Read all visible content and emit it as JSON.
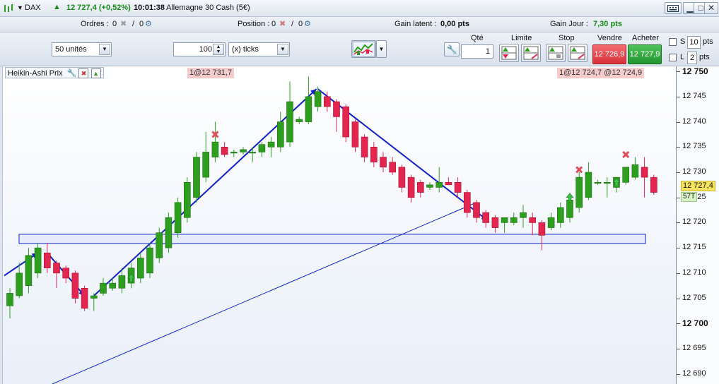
{
  "header": {
    "instrument": "DAX",
    "last_price": "12 727,4 (+0,52%)",
    "time": "10:01:38",
    "description": "Allemagne 30 Cash (5€)"
  },
  "orders_bar": {
    "ordres_label": "Ordres :",
    "ordres_value": "0",
    "ordres_count": "0",
    "position_label": "Position :",
    "position_value": "0",
    "position_count": "0",
    "gain_latent_label": "Gain latent :",
    "gain_latent_value": "0,00 pts",
    "gain_jour_label": "Gain Jour :",
    "gain_jour_value": "7,30 pts"
  },
  "toolbar": {
    "units_select": "50 unités",
    "ticks_value": "100",
    "ticks_select": "(x) ticks",
    "qty_label": "Qté",
    "qty_value": "1",
    "limite_label": "Limite",
    "stop_label": "Stop",
    "vendre_label": "Vendre",
    "vendre_price": "12 726,9",
    "acheter_label": "Acheter",
    "acheter_price": "12 727,9",
    "s_label": "S",
    "s_value": "10",
    "l_label": "L",
    "l_value": "2",
    "pts_label": "pts",
    "colors": {
      "sell": "#e8434b",
      "buy": "#2ea83a"
    }
  },
  "chart": {
    "indicator_label": "Heikin-Ashi Prix",
    "order_pill_left": "1@12 731,7",
    "order_pill_right": "1@12 724,7 @12 724,9",
    "current_price_tag": "12 727,4",
    "volume_tag": "57T",
    "colors": {
      "up": "#2e9e1f",
      "down": "#e32550",
      "trendline": "#1020c8",
      "zone": "#dde6fa"
    }
  },
  "chart_data": {
    "type": "candlestick",
    "style": "Heikin-Ashi",
    "ylim": [
      12688,
      12751
    ],
    "y_ticks": [
      "12 750",
      "12 745",
      "12 740",
      "12 735",
      "12 730",
      "12 725",
      "12 720",
      "12 715",
      "12 710",
      "12 705",
      "12 700",
      "12 695",
      "12 690"
    ],
    "y_tick_values": [
      12750,
      12745,
      12740,
      12735,
      12730,
      12725,
      12720,
      12715,
      12710,
      12705,
      12700,
      12695,
      12690
    ],
    "major_ticks": [
      12750,
      12700
    ],
    "candles": [
      {
        "o": 12703.5,
        "h": 12707,
        "l": 12701,
        "c": 12706
      },
      {
        "o": 12705.5,
        "h": 12712,
        "l": 12705,
        "c": 12710
      },
      {
        "o": 12707.5,
        "h": 12715,
        "l": 12706,
        "c": 12713.5
      },
      {
        "o": 12710,
        "h": 12716,
        "l": 12709,
        "c": 12715
      },
      {
        "o": 12714,
        "h": 12716,
        "l": 12710,
        "c": 12711
      },
      {
        "o": 12712,
        "h": 12712.5,
        "l": 12707,
        "c": 12710
      },
      {
        "o": 12711,
        "h": 12711.5,
        "l": 12708,
        "c": 12709
      },
      {
        "o": 12710,
        "h": 12710.5,
        "l": 12704,
        "c": 12705
      },
      {
        "o": 12707,
        "h": 12707.5,
        "l": 12702.5,
        "c": 12703
      },
      {
        "o": 12705,
        "h": 12706,
        "l": 12702.5,
        "c": 12705.5
      },
      {
        "o": 12706,
        "h": 12709,
        "l": 12705.5,
        "c": 12708
      },
      {
        "o": 12707,
        "h": 12709,
        "l": 12706.5,
        "c": 12708
      },
      {
        "o": 12707,
        "h": 12711,
        "l": 12706,
        "c": 12709.5
      },
      {
        "o": 12708,
        "h": 12712,
        "l": 12707,
        "c": 12711
      },
      {
        "o": 12709,
        "h": 12714,
        "l": 12708,
        "c": 12713
      },
      {
        "o": 12710,
        "h": 12716,
        "l": 12709,
        "c": 12715
      },
      {
        "o": 12713,
        "h": 12719,
        "l": 12712,
        "c": 12718
      },
      {
        "o": 12715,
        "h": 12722,
        "l": 12714,
        "c": 12721
      },
      {
        "o": 12718,
        "h": 12725,
        "l": 12717,
        "c": 12724
      },
      {
        "o": 12721,
        "h": 12729,
        "l": 12720,
        "c": 12728
      },
      {
        "o": 12725,
        "h": 12734,
        "l": 12724,
        "c": 12733
      },
      {
        "o": 12729,
        "h": 12738,
        "l": 12728,
        "c": 12734
      },
      {
        "o": 12733,
        "h": 12740,
        "l": 12732,
        "c": 12736
      },
      {
        "o": 12735,
        "h": 12736,
        "l": 12733,
        "c": 12733.5
      },
      {
        "o": 12734,
        "h": 12734.5,
        "l": 12733,
        "c": 12734
      },
      {
        "o": 12734,
        "h": 12735,
        "l": 12733.5,
        "c": 12734.5
      },
      {
        "o": 12734,
        "h": 12735,
        "l": 12732,
        "c": 12734
      },
      {
        "o": 12734,
        "h": 12736,
        "l": 12733,
        "c": 12735.5
      },
      {
        "o": 12735,
        "h": 12737,
        "l": 12733,
        "c": 12736
      },
      {
        "o": 12735,
        "h": 12742,
        "l": 12734,
        "c": 12740
      },
      {
        "o": 12736,
        "h": 12748,
        "l": 12735,
        "c": 12744
      },
      {
        "o": 12740,
        "h": 12741,
        "l": 12739.5,
        "c": 12740.5
      },
      {
        "o": 12740,
        "h": 12749,
        "l": 12739.5,
        "c": 12745
      },
      {
        "o": 12743,
        "h": 12747,
        "l": 12742,
        "c": 12746
      },
      {
        "o": 12745,
        "h": 12746,
        "l": 12742,
        "c": 12743
      },
      {
        "o": 12744,
        "h": 12744.5,
        "l": 12738,
        "c": 12741
      },
      {
        "o": 12743,
        "h": 12743.5,
        "l": 12736,
        "c": 12737
      },
      {
        "o": 12740,
        "h": 12740.5,
        "l": 12734,
        "c": 12735
      },
      {
        "o": 12737,
        "h": 12737.5,
        "l": 12732,
        "c": 12733
      },
      {
        "o": 12735,
        "h": 12736,
        "l": 12731,
        "c": 12732
      },
      {
        "o": 12733,
        "h": 12734,
        "l": 12730,
        "c": 12731
      },
      {
        "o": 12732,
        "h": 12733,
        "l": 12729.5,
        "c": 12730
      },
      {
        "o": 12731,
        "h": 12731.5,
        "l": 12726,
        "c": 12727
      },
      {
        "o": 12729,
        "h": 12729.5,
        "l": 12724,
        "c": 12725
      },
      {
        "o": 12728,
        "h": 12728.5,
        "l": 12725,
        "c": 12726
      },
      {
        "o": 12727,
        "h": 12728,
        "l": 12726.5,
        "c": 12727.5
      },
      {
        "o": 12727,
        "h": 12731,
        "l": 12726,
        "c": 12728
      },
      {
        "o": 12728,
        "h": 12729,
        "l": 12727.5,
        "c": 12727.5
      },
      {
        "o": 12728,
        "h": 12729,
        "l": 12725,
        "c": 12726
      },
      {
        "o": 12726,
        "h": 12726.5,
        "l": 12721,
        "c": 12722
      },
      {
        "o": 12724,
        "h": 12724.5,
        "l": 12720,
        "c": 12721
      },
      {
        "o": 12722,
        "h": 12722.5,
        "l": 12719,
        "c": 12720
      },
      {
        "o": 12721,
        "h": 12721.5,
        "l": 12718,
        "c": 12719
      },
      {
        "o": 12720,
        "h": 12721,
        "l": 12718,
        "c": 12721
      },
      {
        "o": 12720,
        "h": 12722,
        "l": 12719.5,
        "c": 12721
      },
      {
        "o": 12721,
        "h": 12723.5,
        "l": 12719,
        "c": 12722
      },
      {
        "o": 12721,
        "h": 12722,
        "l": 12717.5,
        "c": 12720
      },
      {
        "o": 12720,
        "h": 12720.5,
        "l": 12714.5,
        "c": 12717.5
      },
      {
        "o": 12719,
        "h": 12722,
        "l": 12718.5,
        "c": 12721
      },
      {
        "o": 12720,
        "h": 12724,
        "l": 12719,
        "c": 12723
      },
      {
        "o": 12721,
        "h": 12725,
        "l": 12720,
        "c": 12724.5
      },
      {
        "o": 12723,
        "h": 12730,
        "l": 12722,
        "c": 12729
      },
      {
        "o": 12725,
        "h": 12732,
        "l": 12724.5,
        "c": 12730
      },
      {
        "o": 12728,
        "h": 12728.5,
        "l": 12727.5,
        "c": 12728
      },
      {
        "o": 12728,
        "h": 12729,
        "l": 12725,
        "c": 12728
      },
      {
        "o": 12727,
        "h": 12729,
        "l": 12726,
        "c": 12729
      },
      {
        "o": 12728,
        "h": 12731,
        "l": 12727.5,
        "c": 12731
      },
      {
        "o": 12729,
        "h": 12733,
        "l": 12728.5,
        "c": 12731.5
      },
      {
        "o": 12731,
        "h": 12733,
        "l": 12725,
        "c": 12729
      },
      {
        "o": 12729,
        "h": 12729.5,
        "l": 12725.5,
        "c": 12726
      }
    ]
  }
}
